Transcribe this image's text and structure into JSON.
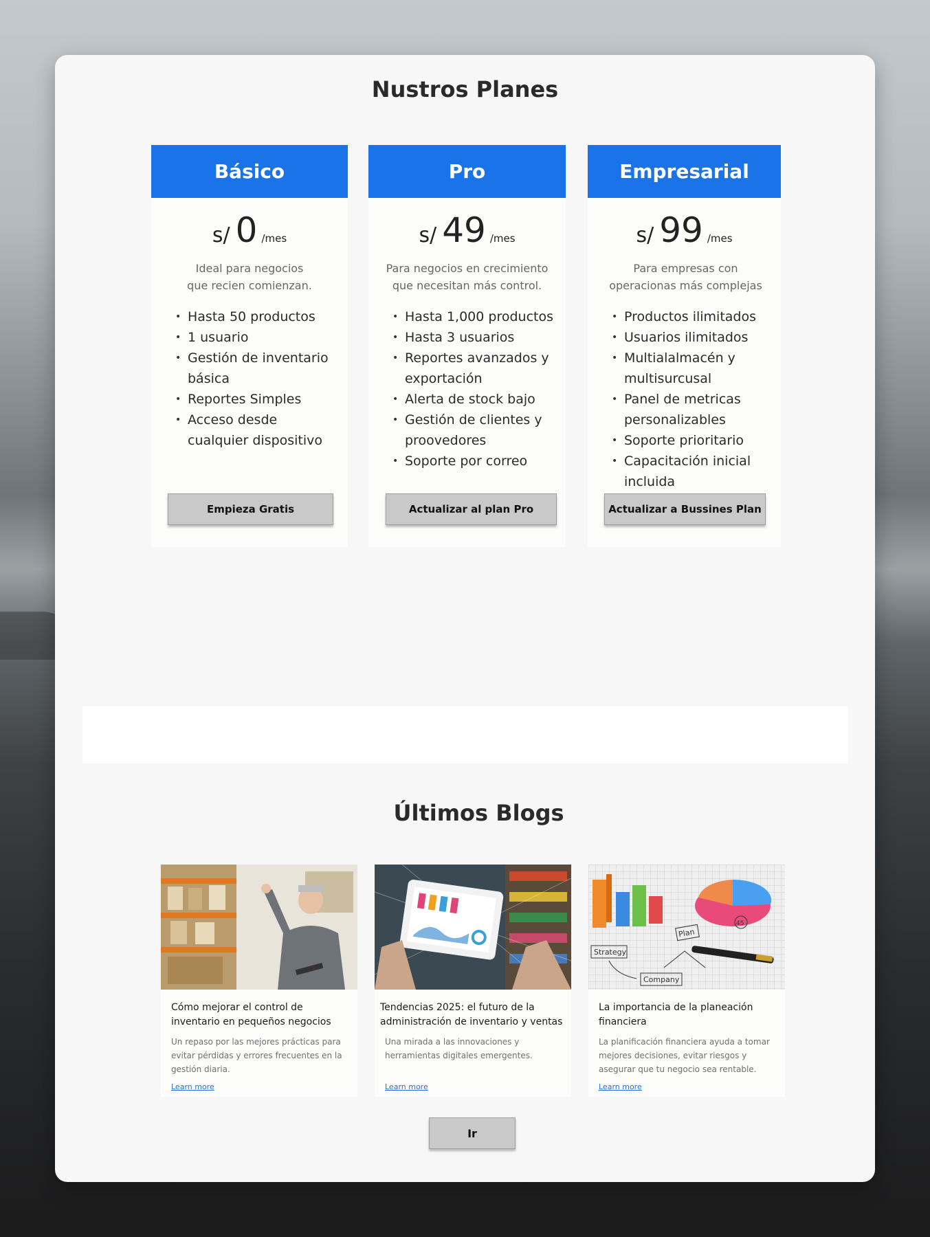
{
  "plans_section": {
    "title": "Nustros Planes",
    "plans": [
      {
        "name": "Básico",
        "currency": "s/",
        "amount": "0",
        "period": "/mes",
        "description": "Ideal para negocios que recien comienzan.",
        "features": [
          "Hasta 50 productos",
          "1 usuario",
          "Gestión de inventario básica",
          "Reportes Simples",
          "Acceso desde cualquier dispositivo"
        ],
        "button": "Empieza Gratis"
      },
      {
        "name": "Pro",
        "currency": "s/",
        "amount": "49",
        "period": "/mes",
        "description": "Para negocios en crecimiento que necesitan más control.",
        "features": [
          "Hasta 1,000 productos",
          "Hasta 3 usuarios",
          "Reportes avanzados y exportación",
          "Alerta de stock bajo",
          "Gestión de clientes y proovedores",
          "Soporte por correo"
        ],
        "button": "Actualizar al plan Pro"
      },
      {
        "name": "Empresarial",
        "currency": "s/",
        "amount": "99",
        "period": "/mes",
        "description": "Para empresas con operacionas más complejas",
        "features": [
          "Productos ilimitados",
          "Usuarios ilimitados",
          "Multialalmacén y multisurcusal",
          "Panel de metricas personalizables",
          "Soporte prioritario",
          "Capacitación inicial incluida"
        ],
        "button": "Actualizar a Bussines Plan"
      }
    ]
  },
  "blogs_section": {
    "title": "Últimos Blogs",
    "posts": [
      {
        "title": "Cómo mejorar el control de inventario en pequeños negocios",
        "excerpt": "Un repaso por las mejores prácticas para evitar pérdidas y errores frecuentes en la gestión diaria.",
        "link": "Learn more"
      },
      {
        "title": "Tendencias 2025: el futuro de la administración de inventario y ventas",
        "excerpt": "Una mirada a las innovaciones y herramientas digitales emergentes.",
        "link": "Learn more"
      },
      {
        "title": "La importancia de la planeación financiera",
        "excerpt": "La planificación financiera ayuda a tomar mejores decisiones, evitar riesgos y asegurar que tu negocio sea rentable.",
        "link": "Learn more",
        "image_labels": [
          "Strategy",
          "Plan",
          "Company",
          "45"
        ]
      }
    ],
    "button": "Ir"
  }
}
